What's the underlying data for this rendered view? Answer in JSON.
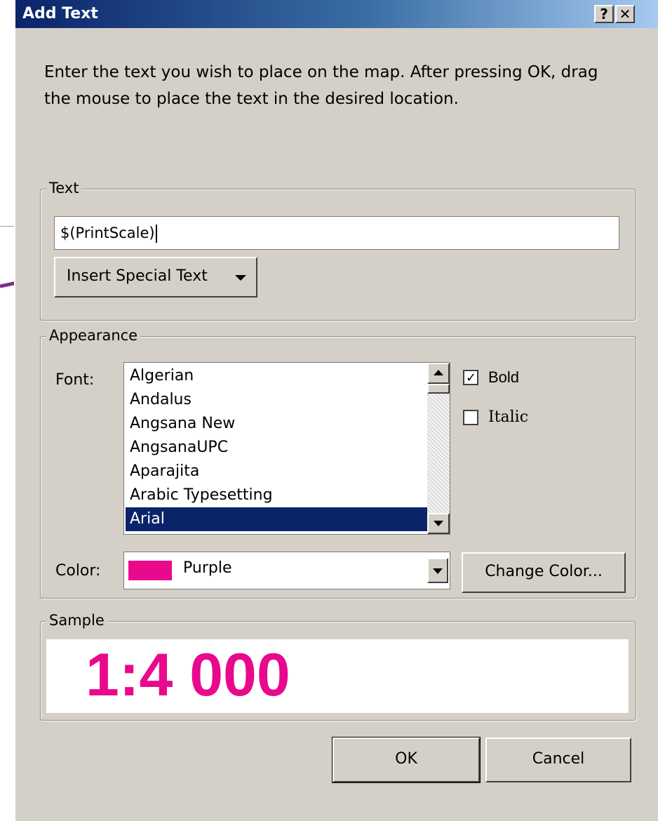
{
  "window": {
    "title": "Add Text",
    "help_glyph": "?",
    "close_glyph": "✕"
  },
  "instructions": "Enter the text you wish to place on the map. After pressing OK, drag the mouse to place the text in the desired location.",
  "text_group": {
    "label": "Text",
    "input_value": "$(PrintScale)",
    "insert_button_label": "Insert Special Text"
  },
  "appearance": {
    "label": "Appearance",
    "font_label": "Font:",
    "fonts": [
      "Algerian",
      "Andalus",
      "Angsana New",
      "AngsanaUPC",
      "Aparajita",
      "Arabic Typesetting",
      "Arial"
    ],
    "selected_font": "Arial",
    "bold_label": "Bold",
    "bold_checked": true,
    "italic_label": "Italic",
    "italic_checked": false,
    "color_label": "Color:",
    "color_name": "Purple",
    "color_hex": "#e8098c",
    "change_color_label": "Change Color..."
  },
  "sample": {
    "label": "Sample",
    "text": "1:4 000",
    "color_hex": "#e8098c"
  },
  "buttons": {
    "ok": "OK",
    "cancel": "Cancel"
  },
  "annotation_color": "#7b2d8e"
}
